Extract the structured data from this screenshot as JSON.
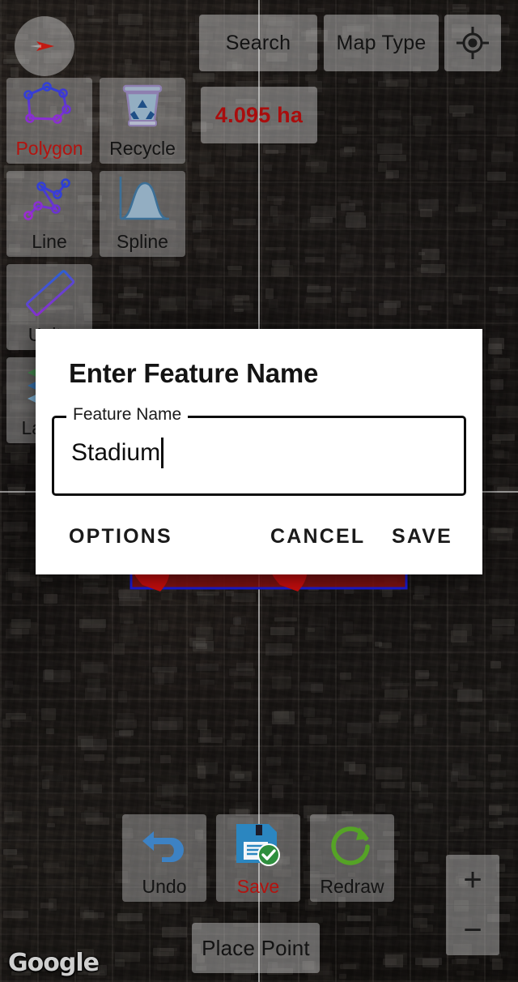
{
  "app": {
    "map_attribution": "Google"
  },
  "map": {
    "compass_icon": "compass-needle-icon",
    "crosshair": "map-crosshair",
    "area_readout": "4.095 ha",
    "area_color": "#a90d0d",
    "polygon_stroke": "#1a1ad0",
    "polygon_fill": "#8a1111",
    "marker_color": "#c20d0d"
  },
  "top_bar": {
    "search_label": "Search",
    "map_type_label": "Map Type",
    "gps_icon": "gps-target-icon"
  },
  "tools": [
    {
      "id": "polygon",
      "label": "Polygon",
      "icon": "polygon-shape-icon",
      "accent": true
    },
    {
      "id": "recycle",
      "label": "Recycle",
      "icon": "recycle-bin-icon",
      "accent": false
    },
    {
      "id": "line",
      "label": "Line",
      "icon": "polyline-icon",
      "accent": false
    },
    {
      "id": "spline",
      "label": "Spline",
      "icon": "spline-curve-icon",
      "accent": false
    },
    {
      "id": "units",
      "label": "Units",
      "icon": "ruler-icon",
      "accent": false
    },
    {
      "id": "layers",
      "label": "Layers",
      "icon": "layers-stack-icon",
      "accent": false
    }
  ],
  "bottom_bar": {
    "undo_label": "Undo",
    "undo_icon": "undo-arrow-icon",
    "save_label": "Save",
    "save_icon": "floppy-disk-check-icon",
    "save_accent": "#c4140d",
    "redraw_label": "Redraw",
    "redraw_icon": "redraw-refresh-icon",
    "place_point_label": "Place Point"
  },
  "zoom_controls": {
    "zoom_in_label": "+",
    "zoom_out_label": "−"
  },
  "dialog": {
    "title": "Enter Feature Name",
    "field_label": "Feature Name",
    "field_value": "Stadium",
    "field_placeholder": "Feature Name",
    "options_label": "OPTIONS",
    "cancel_label": "CANCEL",
    "save_label": "SAVE"
  }
}
